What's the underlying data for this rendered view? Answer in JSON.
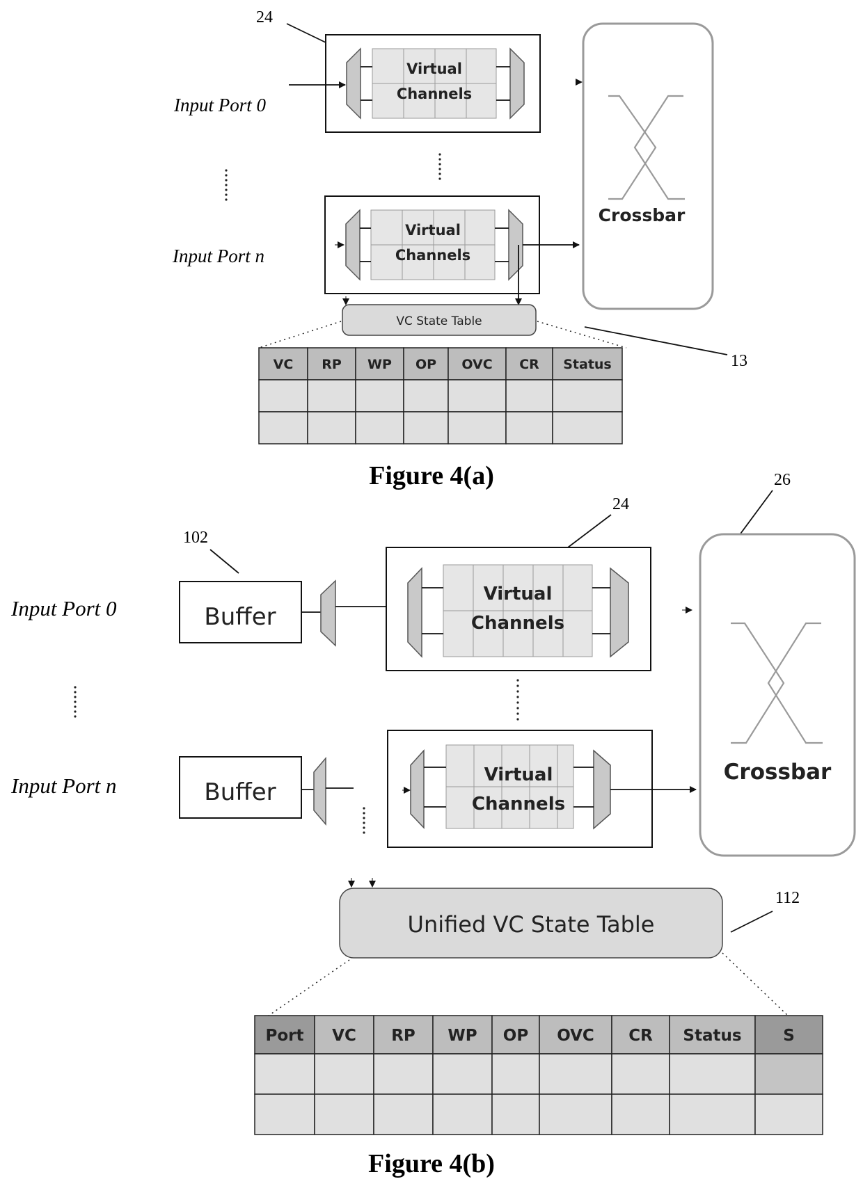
{
  "figure_a": {
    "caption": "Figure 4(a)",
    "ref_vc_block": "24",
    "ref_state_table": "13",
    "input_port_top": "Input Port 0",
    "input_port_bottom": "Input Port n",
    "vc_label_line1": "Virtual",
    "vc_label_line2": "Channels",
    "crossbar_label": "Crossbar",
    "state_table_label": "VC State Table",
    "table": {
      "columns": [
        "VC",
        "RP",
        "WP",
        "OP",
        "OVC",
        "CR",
        "Status"
      ],
      "rows": [
        [
          "",
          "",
          "",
          "",
          "",
          "",
          ""
        ],
        [
          "",
          "",
          "",
          "",
          "",
          "",
          ""
        ]
      ]
    }
  },
  "figure_b": {
    "caption": "Figure 4(b)",
    "ref_buffer": "102",
    "ref_vc_block": "24",
    "ref_crossbar": "26",
    "ref_state_table": "112",
    "input_port_top": "Input Port 0",
    "input_port_bottom": "Input Port n",
    "buffer_label": "Buffer",
    "vc_label_line1": "Virtual",
    "vc_label_line2": "Channels",
    "crossbar_label": "Crossbar",
    "state_table_label": "Unified VC State Table",
    "table": {
      "columns": [
        "Port",
        "VC",
        "RP",
        "WP",
        "OP",
        "OVC",
        "CR",
        "Status",
        "S"
      ],
      "rows": [
        [
          "",
          "",
          "",
          "",
          "",
          "",
          "",
          "",
          ""
        ],
        [
          "",
          "",
          "",
          "",
          "",
          "",
          "",
          "",
          ""
        ]
      ]
    }
  }
}
